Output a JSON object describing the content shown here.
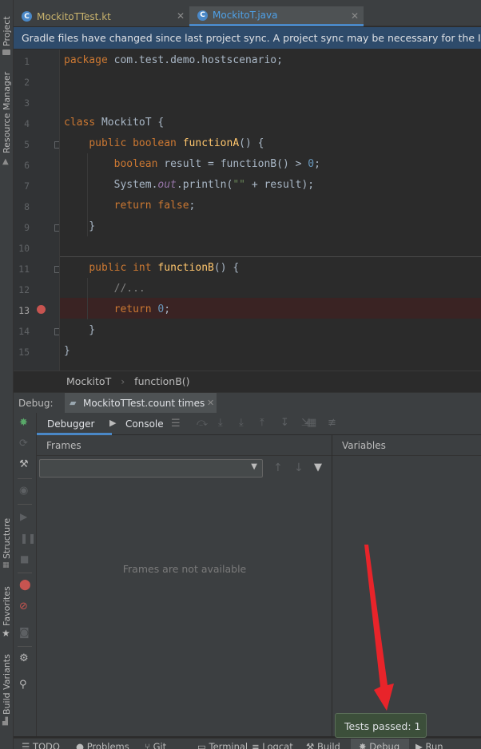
{
  "left_strip": {
    "project": "Project",
    "resource_manager": "Resource Manager",
    "structure": "Structure",
    "favorites": "Favorites",
    "build_variants": "Build Variants"
  },
  "tabs": [
    {
      "label": "MockitoTTest.kt",
      "icon": "kotlin-class-icon",
      "active": false
    },
    {
      "label": "MockitoT.java",
      "icon": "java-class-icon",
      "active": true
    }
  ],
  "notification": "Gradle files have changed since last project sync. A project sync may be necessary for the IDE to w",
  "editor": {
    "line_numbers": [
      "1",
      "2",
      "3",
      "4",
      "5",
      "6",
      "7",
      "8",
      "9",
      "10",
      "11",
      "12",
      "13",
      "14",
      "15"
    ],
    "breakpoint_line": "13"
  },
  "breadcrumb": {
    "class_name": "MockitoT",
    "method_name": "functionB()"
  },
  "debug": {
    "label": "Debug:",
    "session": "MockitoTTest.count times",
    "debugger_tab": "Debugger",
    "console_tab": "Console",
    "frames_title": "Frames",
    "variables_title": "Variables",
    "frames_empty": "Frames are not available"
  },
  "toast": "Tests passed: 1",
  "statusbar": {
    "todo": "TODO",
    "problems": "Problems",
    "git": "Git",
    "terminal": "Terminal",
    "logcat": "Logcat",
    "build": "Build",
    "debug": "Debug",
    "run": "Run"
  },
  "colors": {
    "accent": "#4a88c7",
    "breakpoint": "#c75450",
    "toast_bg": "#3c4f3a",
    "annotation_arrow": "#e8242a"
  }
}
